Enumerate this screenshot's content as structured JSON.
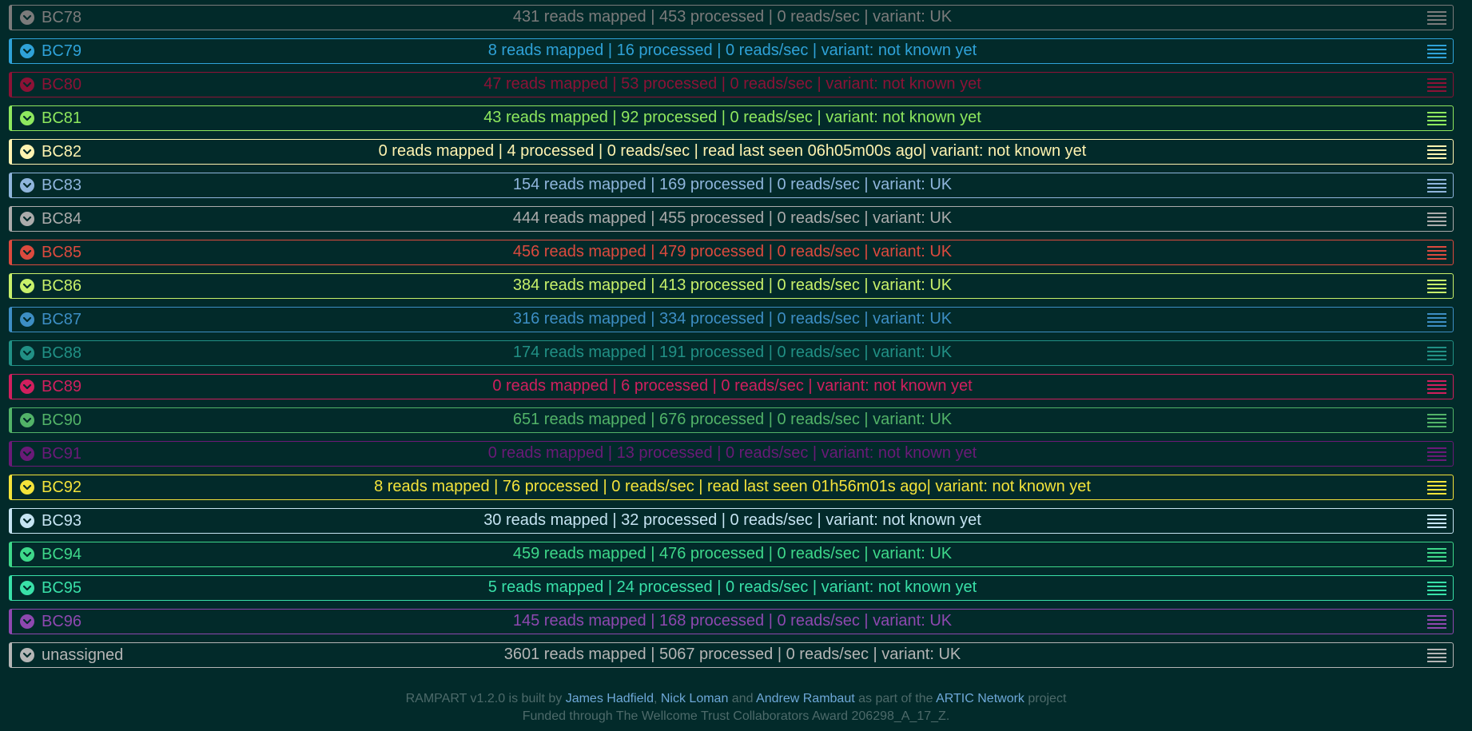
{
  "barcodes": [
    {
      "name": "BC78",
      "stats": "431 reads mapped | 453 processed | 0 reads/sec | variant: UK",
      "color": "#7b7b7b"
    },
    {
      "name": "BC79",
      "stats": "8 reads mapped | 16 processed | 0 reads/sec | variant: not known yet",
      "color": "#2fa2d8"
    },
    {
      "name": "BC80",
      "stats": "47 reads mapped | 53 processed | 0 reads/sec | variant: not known yet",
      "color": "#8c1236"
    },
    {
      "name": "BC81",
      "stats": "43 reads mapped | 92 processed | 0 reads/sec | variant: not known yet",
      "color": "#8ee85e"
    },
    {
      "name": "BC82",
      "stats": "0 reads mapped | 4 processed | 0 reads/sec | read last seen 06h05m00s ago| variant: not known yet",
      "color": "#fff3b0"
    },
    {
      "name": "BC83",
      "stats": "154 reads mapped | 169 processed | 0 reads/sec | variant: UK",
      "color": "#8fb5dc"
    },
    {
      "name": "BC84",
      "stats": "444 reads mapped | 455 processed | 0 reads/sec | variant: UK",
      "color": "#ababab"
    },
    {
      "name": "BC85",
      "stats": "456 reads mapped | 479 processed | 0 reads/sec | variant: UK",
      "color": "#dc4a3e"
    },
    {
      "name": "BC86",
      "stats": "384 reads mapped | 413 processed | 0 reads/sec | variant: UK",
      "color": "#c8f06a"
    },
    {
      "name": "BC87",
      "stats": "316 reads mapped | 334 processed | 0 reads/sec | variant: UK",
      "color": "#3d8ec4"
    },
    {
      "name": "BC88",
      "stats": "174 reads mapped | 191 processed | 0 reads/sec | variant: UK",
      "color": "#219085"
    },
    {
      "name": "BC89",
      "stats": "0 reads mapped | 6 processed | 0 reads/sec | variant: not known yet",
      "color": "#d11f5e"
    },
    {
      "name": "BC90",
      "stats": "651 reads mapped | 676 processed | 0 reads/sec | variant: UK",
      "color": "#52b368"
    },
    {
      "name": "BC91",
      "stats": "0 reads mapped | 13 processed | 0 reads/sec | variant: not known yet",
      "color": "#6a1a78"
    },
    {
      "name": "BC92",
      "stats": "8 reads mapped | 76 processed | 0 reads/sec | read last seen 01h56m01s ago| variant: not known yet",
      "color": "#f4e33a"
    },
    {
      "name": "BC93",
      "stats": "30 reads mapped | 32 processed | 0 reads/sec | variant: not known yet",
      "color": "#c6e4f2"
    },
    {
      "name": "BC94",
      "stats": "459 reads mapped | 476 processed | 0 reads/sec | variant: UK",
      "color": "#3ed88a"
    },
    {
      "name": "BC95",
      "stats": "5 reads mapped | 24 processed | 0 reads/sec | variant: not known yet",
      "color": "#39e0a8"
    },
    {
      "name": "BC96",
      "stats": "145 reads mapped | 168 processed | 0 reads/sec | variant: UK",
      "color": "#8e48b0"
    },
    {
      "name": "unassigned",
      "stats": "3601 reads mapped | 5067 processed | 0 reads/sec | variant: UK",
      "color": "#b5b5b5"
    }
  ],
  "footer": {
    "line1_prefix": "RAMPART v1.2.0 is built by ",
    "author1": "James Hadfield",
    "sep1": ", ",
    "author2": "Nick Loman",
    "sep2": " and ",
    "author3": "Andrew Rambaut",
    "mid": " as part of the ",
    "network": "ARTIC Network",
    "suffix": " project",
    "line2": "Funded through The Wellcome Trust Collaborators Award 206298_A_17_Z."
  }
}
